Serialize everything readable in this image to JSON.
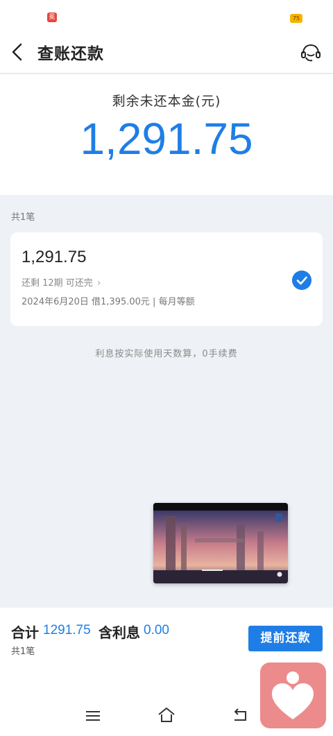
{
  "status_bar": {
    "left_icon_label": "冕",
    "right_badge": "75"
  },
  "header": {
    "title": "查账还款",
    "back_icon": "chevron-left",
    "service_icon": "customer-service-headset"
  },
  "summary": {
    "label": "剩余未还本金(元)",
    "amount": "1,291.75"
  },
  "list": {
    "count": "共1笔",
    "loans": [
      {
        "amount": "1,291.75",
        "terms": "还剩 12期 可还完",
        "info": "2024年6月20日 借1,395.00元 | 每月等额",
        "selected": true
      }
    ],
    "interest_note": "利息按实际使用天数算，0手续费"
  },
  "bottom_bar": {
    "total_label": "合计",
    "total_value": "1291.75",
    "interest_label": "含利息",
    "interest_value": "0.00",
    "count": "共1笔",
    "prepay_button": "提前还款"
  },
  "colors": {
    "accent": "#1f7ee6",
    "background": "#eef1f5",
    "widget": "#ec8b8c"
  }
}
